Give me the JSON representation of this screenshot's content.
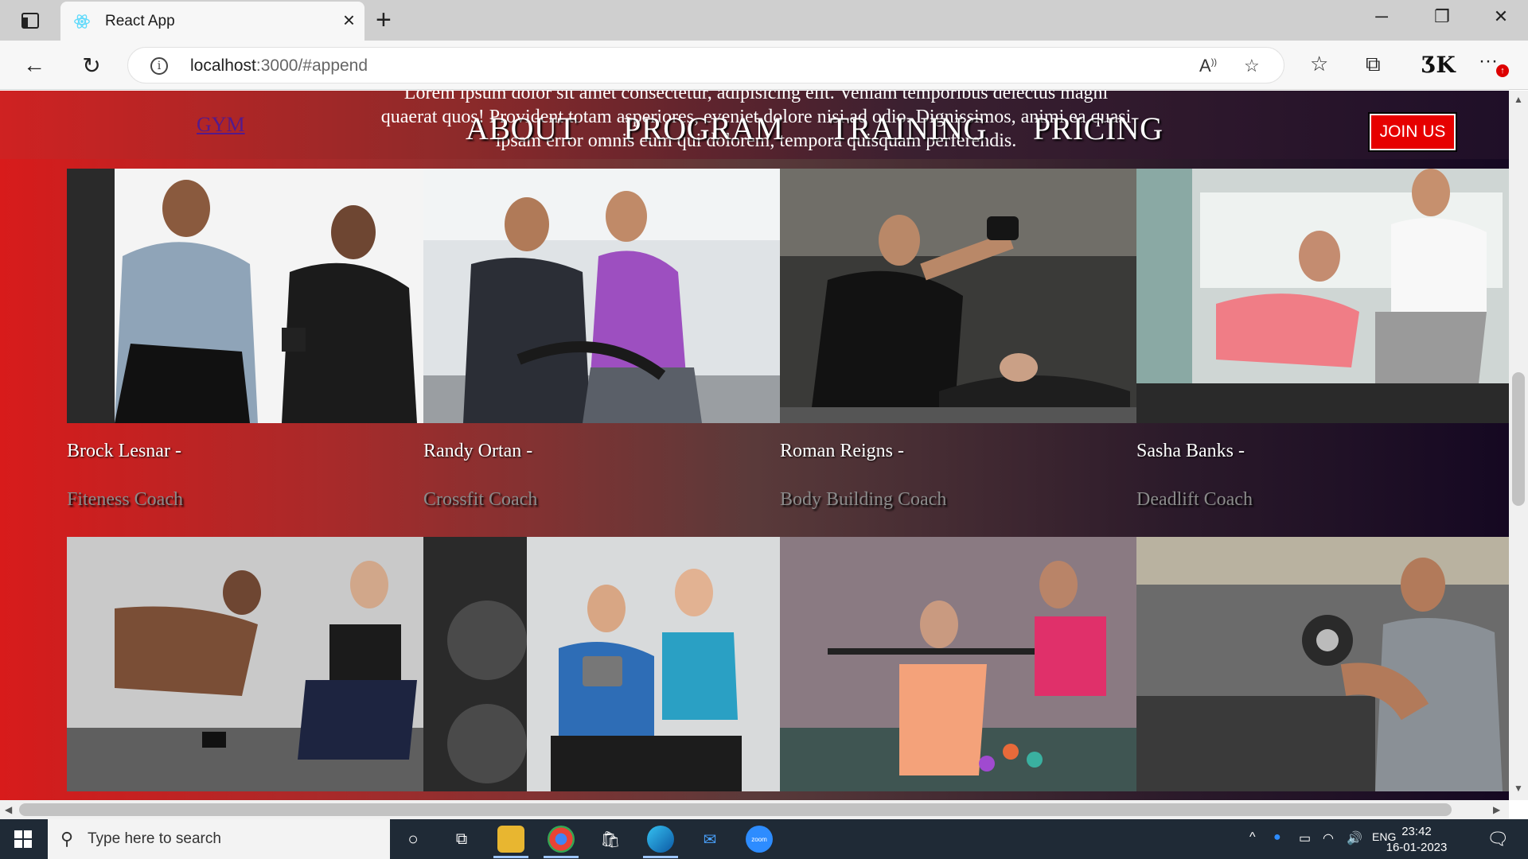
{
  "browser": {
    "tab_title": "React App",
    "url_host": "localhost",
    "url_path": ":3000/#append"
  },
  "site": {
    "logo": "GYM",
    "hero_text": "Lorem ipsum dolor sit amet consectetur, adipisicing elit. Veniam temporibus delectus magni quaerat quos! Provident totam asperiores, eveniet dolore nisi ad odio. Dignissimos, animi ea quasi ipsam error omnis eum qui dolorem, tempora quisquam perferendis.",
    "nav": [
      "ABOUT",
      "PROGRAM",
      "TRAINING",
      "PRICING"
    ],
    "join_label": "JOIN US"
  },
  "coaches": [
    {
      "name": "Brock Lesnar -",
      "role": "Fiteness Coach"
    },
    {
      "name": "Randy Ortan -",
      "role": "Crossfit Coach"
    },
    {
      "name": "Roman Reigns -",
      "role": "Body Building Coach"
    },
    {
      "name": "Sasha Banks -",
      "role": "Deadlift Coach"
    }
  ],
  "taskbar": {
    "search_placeholder": "Type here to search",
    "language": "ENG",
    "time": "23:42",
    "date": "16-01-2023",
    "zoom_label": "zoom"
  },
  "colors": {
    "join_button": "#e60000",
    "header_left": "#cf2222",
    "header_right": "#1f0f28"
  }
}
